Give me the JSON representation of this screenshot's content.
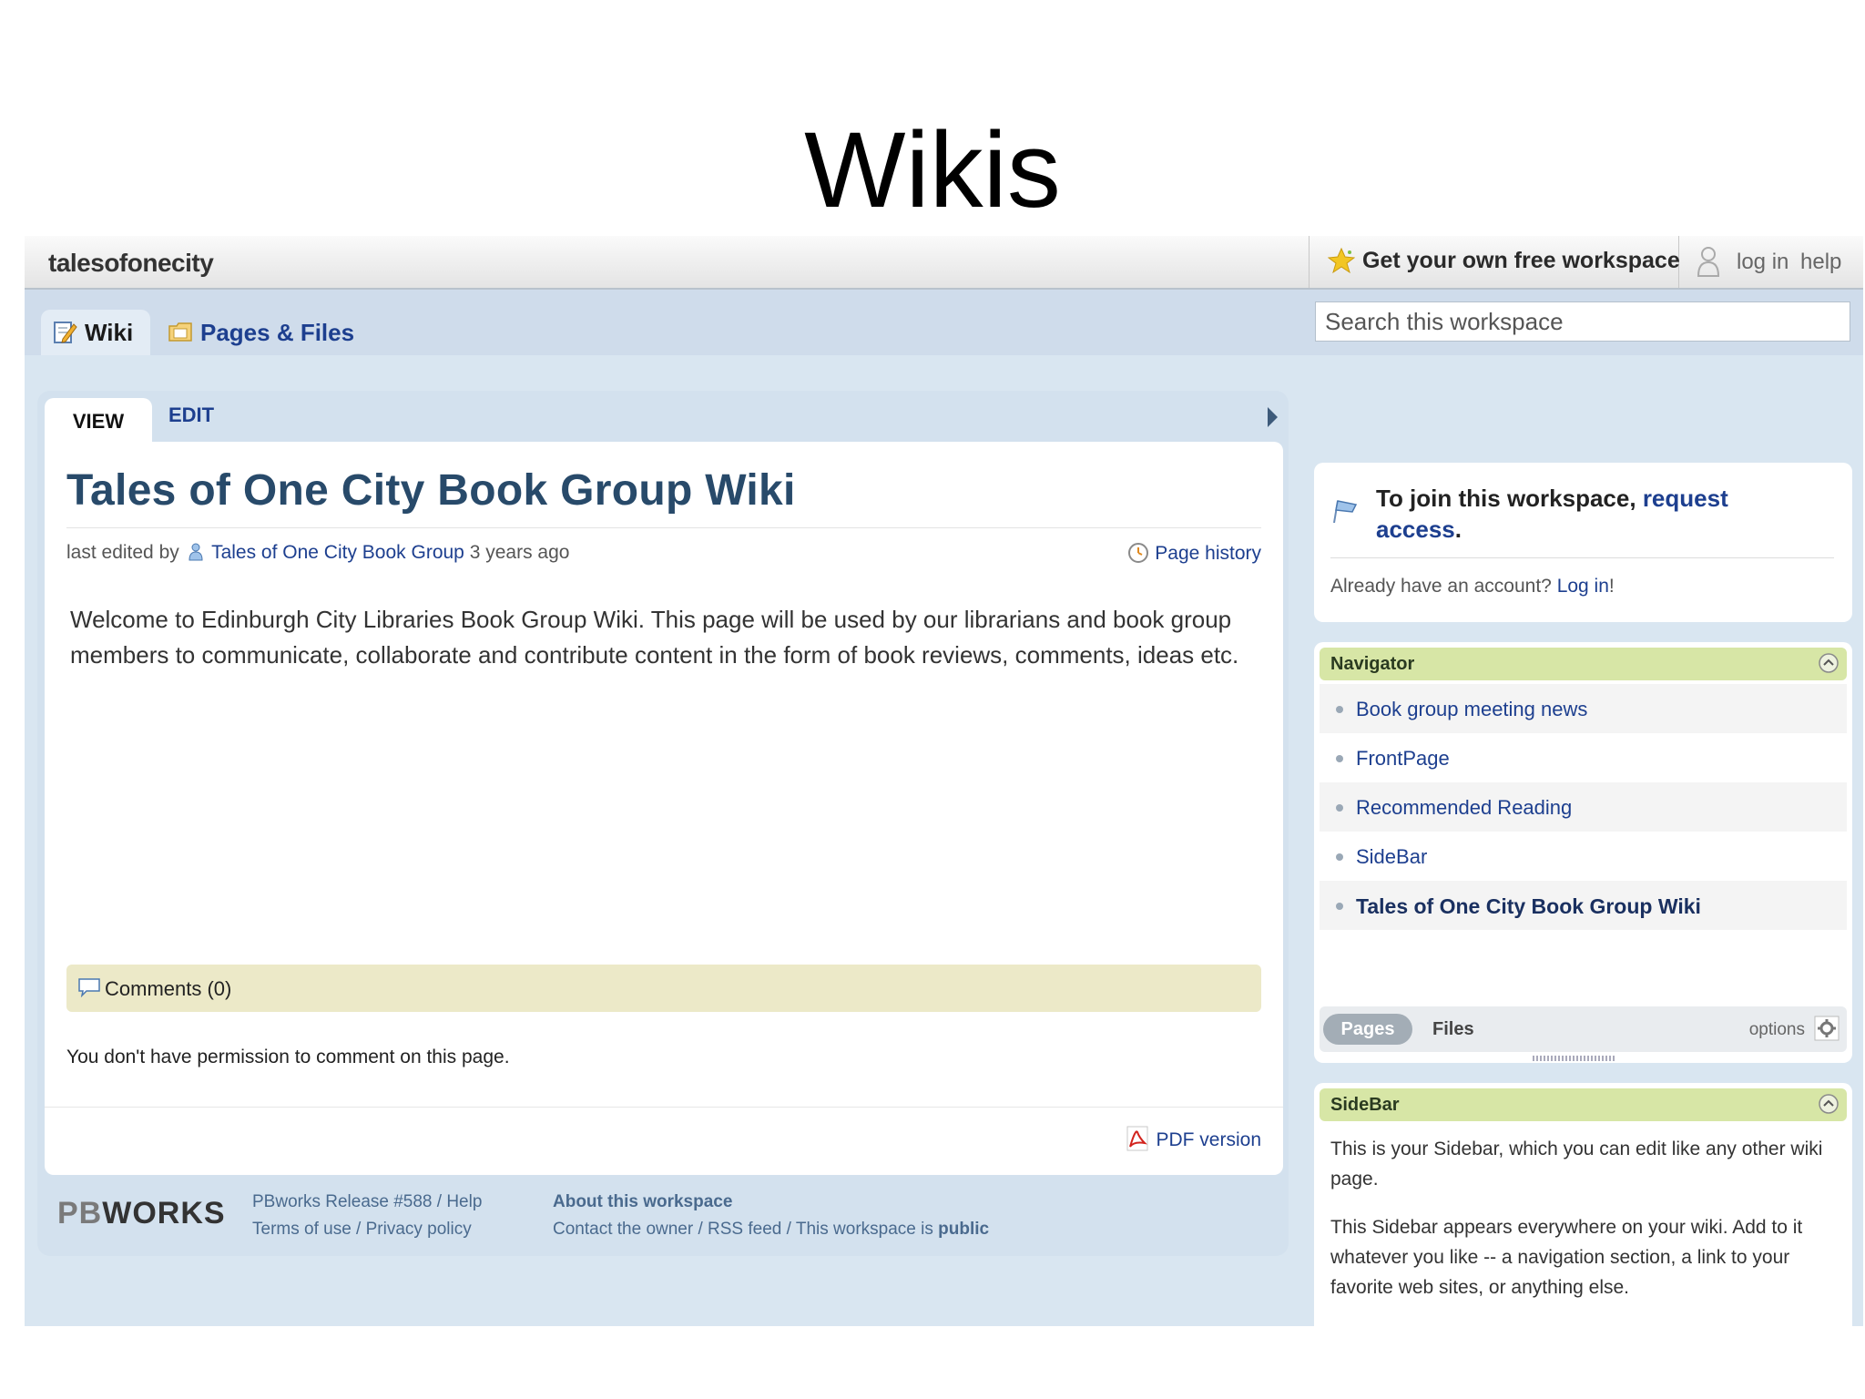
{
  "slide_title": "Wikis",
  "topbar": {
    "workspace_name": "talesofonecity",
    "get_workspace_label": "Get your own free workspace",
    "login_label": "log in",
    "help_label": "help"
  },
  "nav": {
    "tabs": [
      {
        "label": "Wiki",
        "icon": "edit-page-icon"
      },
      {
        "label": "Pages & Files",
        "icon": "folder-icon"
      }
    ],
    "search_placeholder": "Search this workspace"
  },
  "page": {
    "view_tab": "VIEW",
    "edit_tab": "EDIT",
    "title": "Tales of One City Book Group Wiki",
    "last_edited_prefix": "last edited by",
    "author": "Tales of One City Book Group",
    "edited_when": "3 years ago",
    "page_history": "Page history",
    "body": "Welcome to Edinburgh City Libraries Book Group Wiki.  This page will be used by our librarians and book group members to communicate, collaborate and contribute content in the form of book reviews, comments, ideas etc.",
    "comments_label": "Comments (0)",
    "no_permission": "You don't have permission to comment on this page.",
    "pdf_label": "PDF version"
  },
  "footer": {
    "logo_pb": "PB",
    "logo_works": "WORKS",
    "release": "PBworks Release #588 / Help",
    "terms": "Terms of use / Privacy policy",
    "about_title": "About this workspace",
    "contact": "Contact the owner / RSS feed / This workspace is",
    "public_word": "public"
  },
  "join": {
    "text_prefix": "To join this workspace,",
    "request_link": "request access",
    "text_suffix": ".",
    "already_prefix": "Already have an account?",
    "login_link": "Log in",
    "already_suffix": "!"
  },
  "navigator": {
    "header": "Navigator",
    "items": [
      {
        "label": "Book group meeting news"
      },
      {
        "label": "FrontPage"
      },
      {
        "label": "Recommended Reading"
      },
      {
        "label": "SideBar"
      },
      {
        "label": "Tales of One City Book Group Wiki"
      }
    ],
    "pages_tab": "Pages",
    "files_tab": "Files",
    "options_label": "options"
  },
  "sidebar": {
    "header": "SideBar",
    "para1": "This is your Sidebar, which you can edit like any other wiki page.",
    "para2": "This Sidebar appears everywhere on your wiki. Add to it whatever you like -- a navigation section, a link to your favorite web sites, or anything else."
  }
}
